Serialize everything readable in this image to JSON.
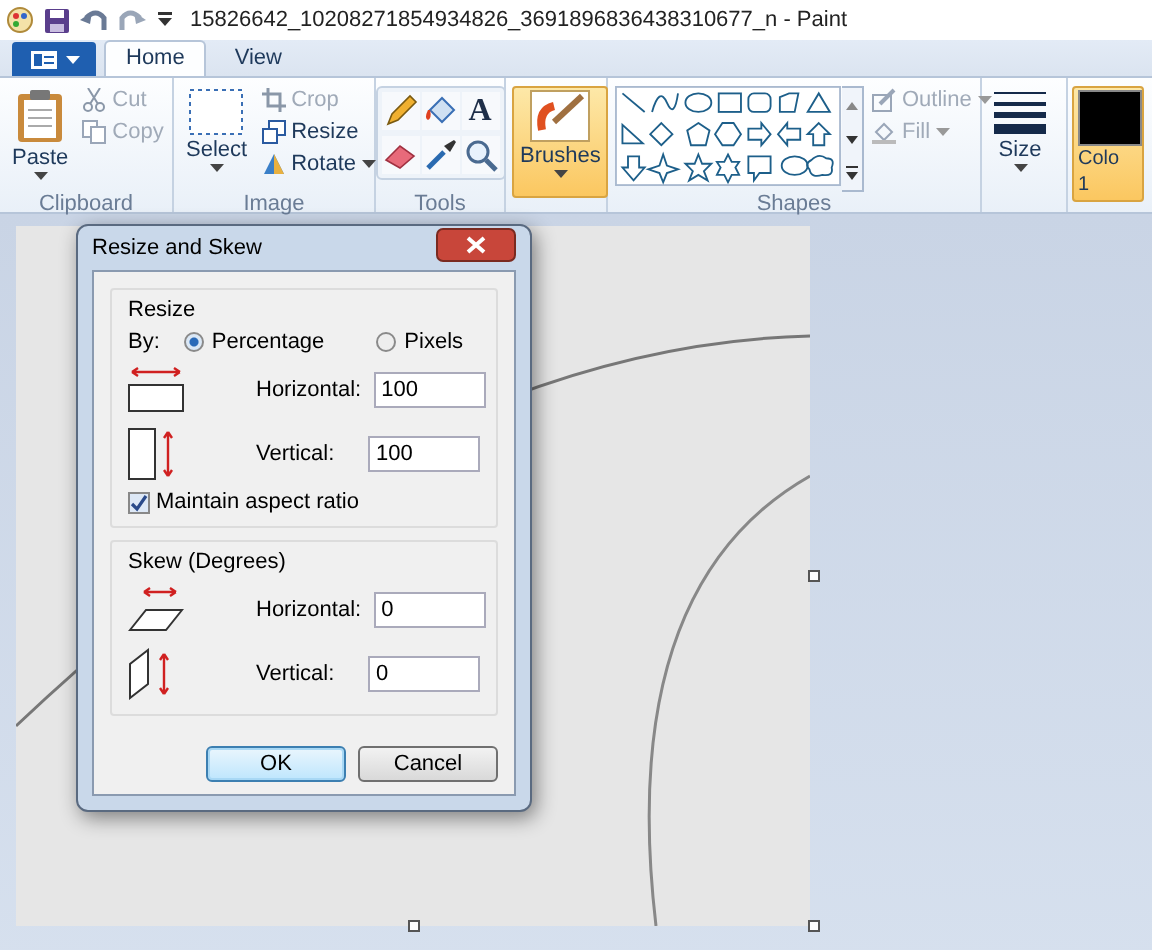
{
  "title_bar": {
    "title": "15826642_10208271854934826_3691896836438310677_n - Paint"
  },
  "tabs": [
    {
      "label": "Home",
      "selected": true
    },
    {
      "label": "View",
      "selected": false
    }
  ],
  "ribbon": {
    "clipboard": {
      "label": "Clipboard",
      "paste": {
        "label": "Paste"
      },
      "cut": {
        "label": "Cut",
        "disabled": true
      },
      "copy": {
        "label": "Copy",
        "disabled": true
      }
    },
    "image": {
      "label": "Image",
      "select": {
        "label": "Select"
      },
      "crop": {
        "label": "Crop",
        "disabled": true
      },
      "resize": {
        "label": "Resize",
        "disabled": false
      },
      "rotate": {
        "label": "Rotate",
        "disabled": false
      }
    },
    "tools": {
      "label": "Tools",
      "text_tool": "A"
    },
    "brushes": {
      "label": "Brushes",
      "selected": true
    },
    "shapes": {
      "label": "Shapes",
      "outline": {
        "label": "Outline",
        "disabled": true
      },
      "fill": {
        "label": "Fill",
        "disabled": true
      }
    },
    "size": {
      "label": "Size"
    },
    "color": {
      "label": "Colo",
      "number": "1"
    }
  },
  "dialog": {
    "title": "Resize and Skew",
    "resize": {
      "label": "Resize",
      "by": "By:",
      "options": [
        {
          "label": "Percentage",
          "selected": true
        },
        {
          "label": "Pixels",
          "selected": false
        }
      ],
      "fields": [
        {
          "kind": "horizontal",
          "label": "Horizontal:",
          "value": "100"
        },
        {
          "kind": "vertical",
          "label": "Vertical:",
          "value": "100"
        }
      ],
      "maintain": {
        "label": "Maintain aspect ratio",
        "checked": true
      }
    },
    "skew": {
      "label": "Skew (Degrees)",
      "fields": [
        {
          "kind": "horizontal",
          "label": "Horizontal:",
          "value": "0"
        },
        {
          "kind": "vertical",
          "label": "Vertical:",
          "value": "0"
        }
      ]
    },
    "buttons": [
      {
        "label": "OK",
        "default": true
      },
      {
        "label": "Cancel",
        "default": false
      }
    ]
  }
}
